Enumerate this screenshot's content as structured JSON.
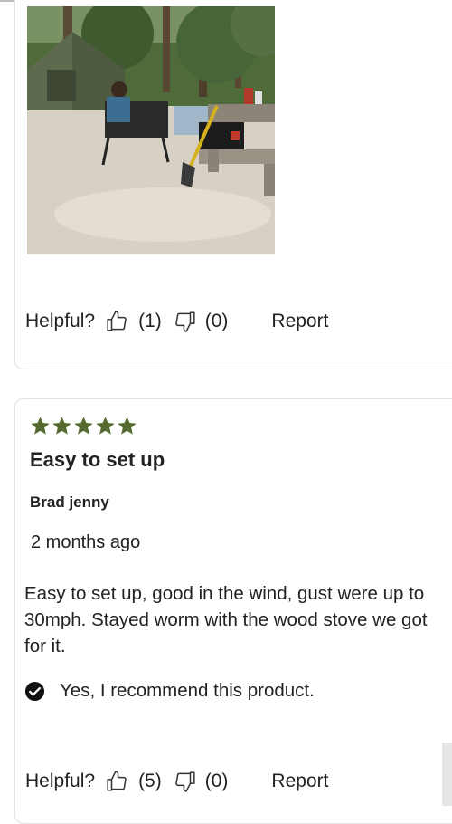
{
  "colors": {
    "star": "#556b2f",
    "text": "#222222",
    "card_border": "#e2e2e2",
    "check_bg": "#111111"
  },
  "review1": {
    "photo_icon": "camping-photo",
    "helpful_label": "Helpful?",
    "upvotes": "(1)",
    "downvotes": "(0)",
    "report_label": "Report"
  },
  "review2": {
    "rating": 5,
    "title": "Easy to set up",
    "author": "Brad jenny",
    "date": "2 months ago",
    "body": "Easy to set up, good in the wind, gust were up to 30mph. Stayed worm with the wood stove we got for it.",
    "recommend_text": "Yes, I recommend this product.",
    "helpful_label": "Helpful?",
    "upvotes": "(5)",
    "downvotes": "(0)",
    "report_label": "Report"
  }
}
